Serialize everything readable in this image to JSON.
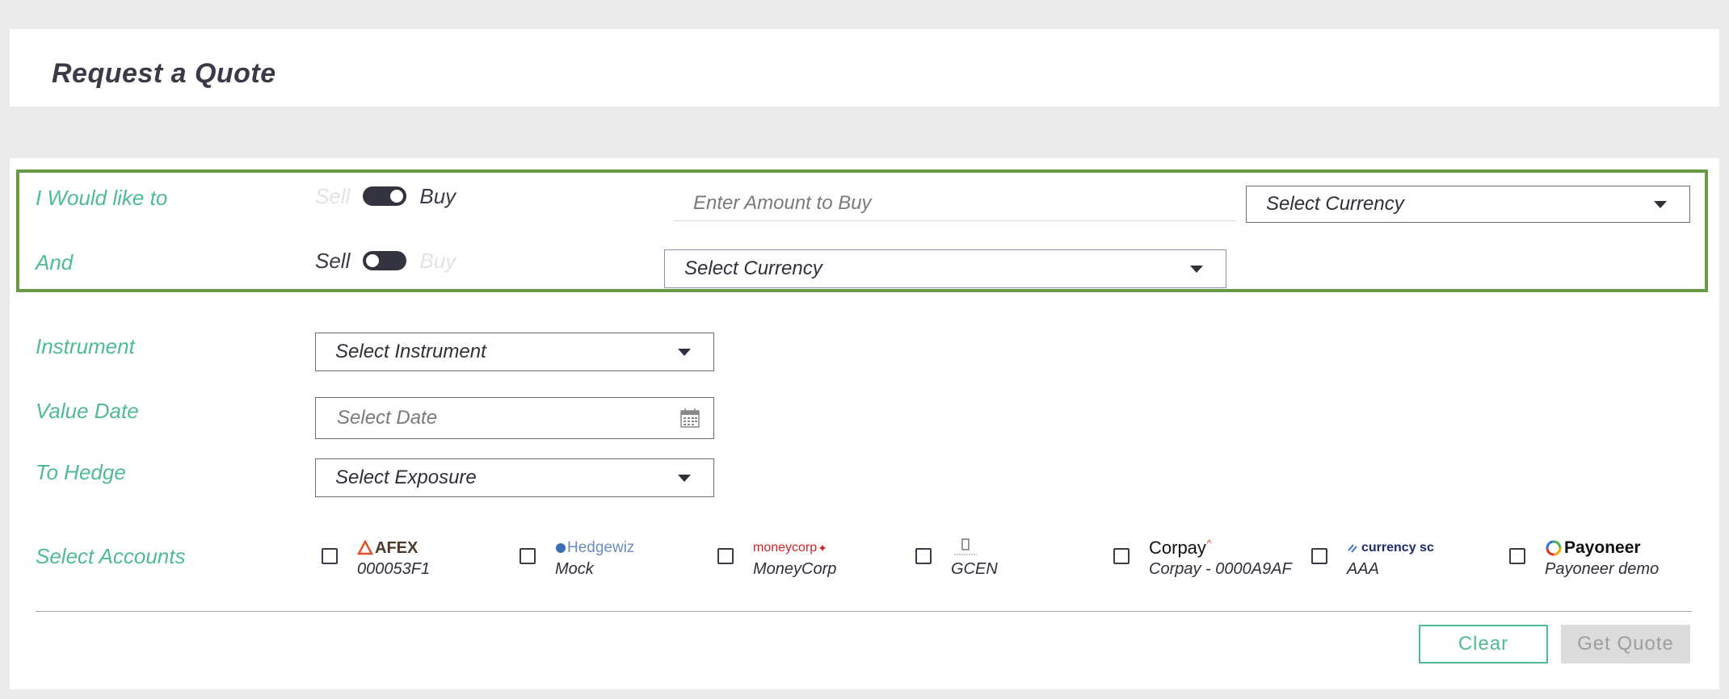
{
  "page": {
    "title": "Request a Quote"
  },
  "trade": {
    "row1": {
      "label": "I Would like to",
      "sell_label": "Sell",
      "buy_label": "Buy",
      "toggle_state": "Buy",
      "amount_placeholder": "Enter Amount to Buy",
      "currency": "Select Currency"
    },
    "row2": {
      "label": "And",
      "sell_label": "Sell",
      "buy_label": "Buy",
      "toggle_state": "Sell",
      "currency": "Select Currency"
    }
  },
  "instrument": {
    "label": "Instrument",
    "value": "Select Instrument"
  },
  "value_date": {
    "label": "Value Date",
    "placeholder": "Select Date"
  },
  "hedge": {
    "label": "To Hedge",
    "value": "Select Exposure"
  },
  "accounts": {
    "label": "Select Accounts",
    "items": [
      {
        "logo_text": "AFEX",
        "name": "000053F1",
        "checked": false,
        "logo_color": "#e0522a"
      },
      {
        "logo_text": "Hedgewiz",
        "name": "Mock",
        "checked": false,
        "logo_color": "#3b6fb5"
      },
      {
        "logo_text": "moneycorp",
        "name": "MoneyCorp",
        "checked": false,
        "logo_color": "#d0232c"
      },
      {
        "logo_text": "",
        "name": "GCEN",
        "checked": false,
        "logo_color": "#555555"
      },
      {
        "logo_text": "Corpay",
        "name": "Corpay - 0000A9AF",
        "checked": false,
        "logo_color": "#111111"
      },
      {
        "logo_text": "currency sc",
        "name": "AAA",
        "checked": false,
        "logo_color": "#1d2a6e"
      },
      {
        "logo_text": "Payoneer",
        "name": "Payoneer demo",
        "checked": false,
        "logo_color": "#111111"
      }
    ]
  },
  "buttons": {
    "clear": "Clear",
    "get_quote": "Get Quote"
  },
  "colors": {
    "accent": "#4fba98",
    "highlight_border": "#6b9a46",
    "toggle": "#343440"
  }
}
